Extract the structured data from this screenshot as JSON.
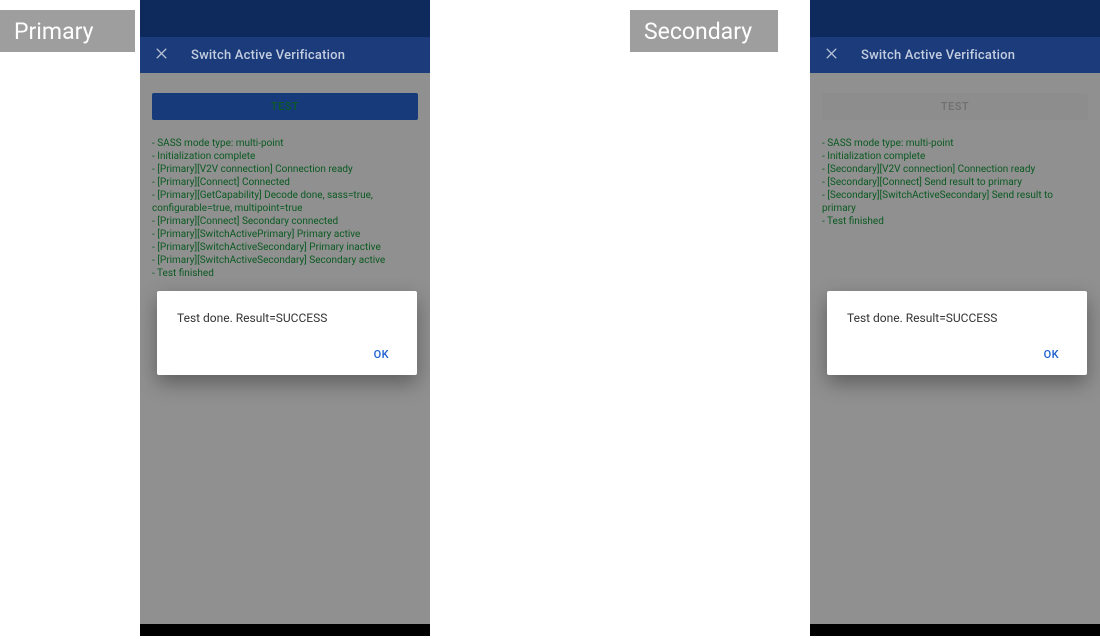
{
  "tags": {
    "primary": "Primary",
    "secondary": "Secondary"
  },
  "left": {
    "title": "Switch Active Verification",
    "test_label": "TEST",
    "log": [
      "- SASS mode type: multi-point",
      "- Initialization complete",
      "- [Primary][V2V connection] Connection ready",
      "- [Primary][Connect] Connected",
      "- [Primary][GetCapability] Decode done, sass=true, configurable=true, multipoint=true",
      "- [Primary][Connect] Secondary connected",
      "- [Primary][SwitchActivePrimary] Primary active",
      "- [Primary][SwitchActiveSecondary] Primary inactive",
      "- [Primary][SwitchActiveSecondary] Secondary active",
      "- Test finished"
    ],
    "dialog": {
      "message": "Test done. Result=SUCCESS",
      "ok": "OK"
    }
  },
  "right": {
    "title": "Switch Active Verification",
    "test_label": "TEST",
    "log": [
      "- SASS mode type: multi-point",
      "- Initialization complete",
      "- [Secondary][V2V connection] Connection ready",
      "- [Secondary][Connect] Send result to primary",
      "- [Secondary][SwitchActiveSecondary] Send result to primary",
      "- Test finished"
    ],
    "dialog": {
      "message": "Test done. Result=SUCCESS",
      "ok": "OK"
    }
  }
}
